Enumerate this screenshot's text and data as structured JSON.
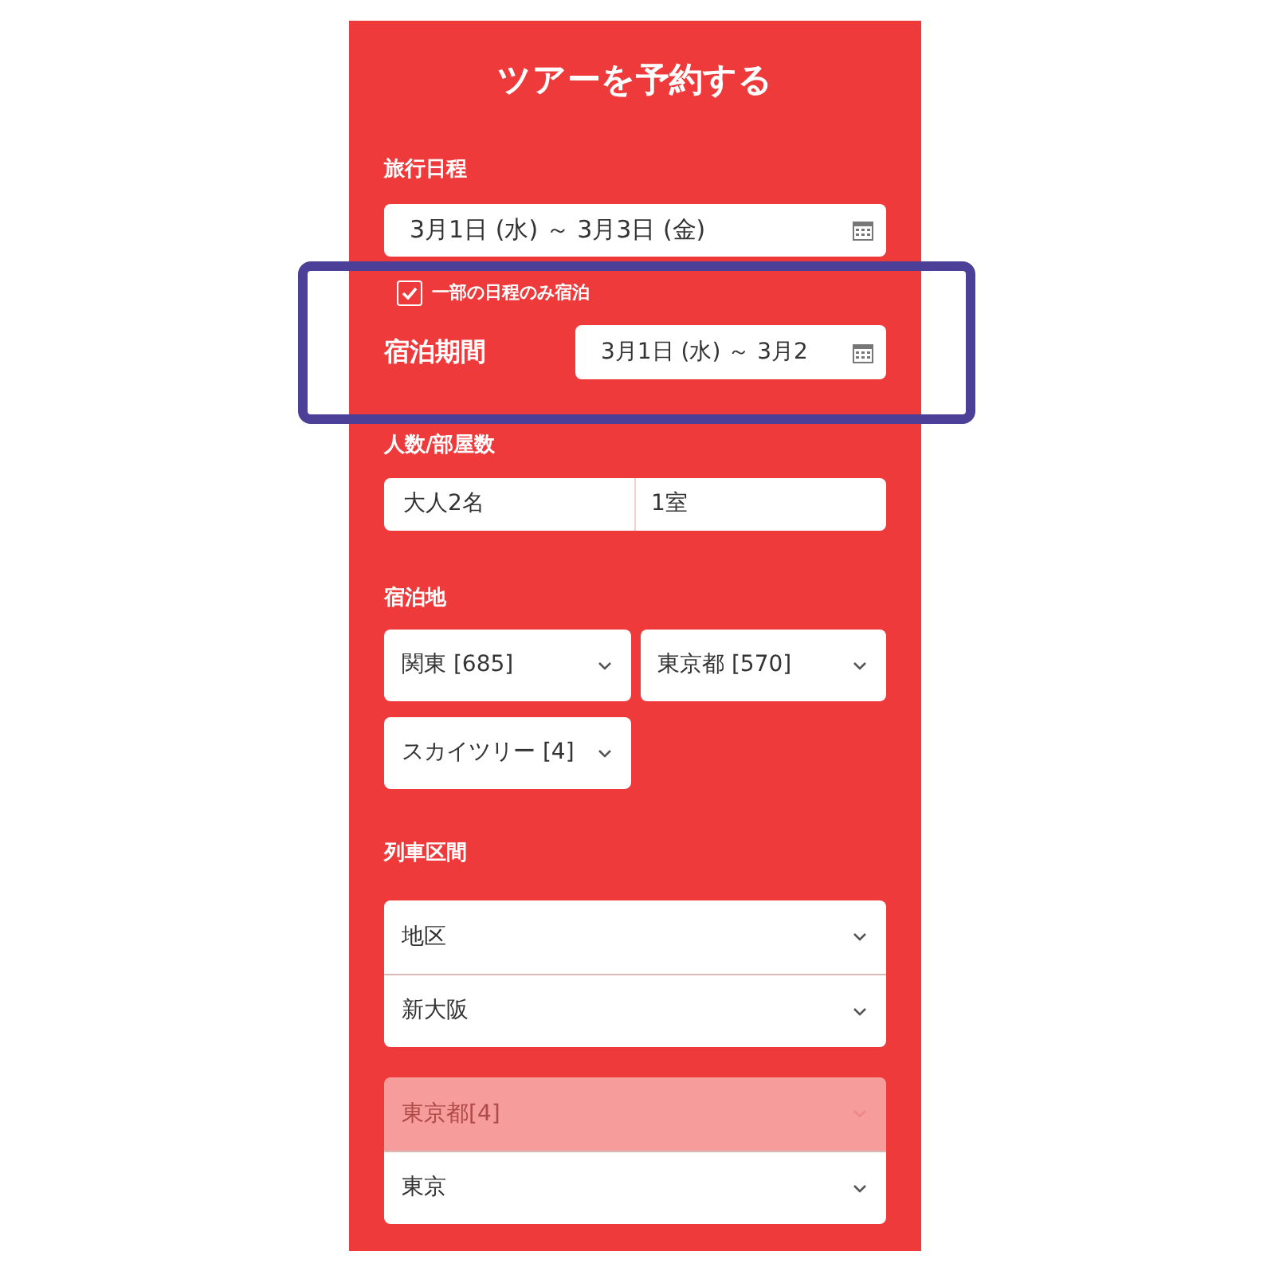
{
  "title": "ツアーを予約する",
  "itinerary": {
    "label": "旅行日程",
    "value": "3月1日 (水) ～ 3月3日 (金)"
  },
  "partial_stay": {
    "label": "一部の日程のみ宿泊",
    "checked": true
  },
  "stay_period": {
    "label": "宿泊期間",
    "value": "3月1日 (水) ～ 3月2"
  },
  "guests": {
    "label": "人数/部屋数",
    "adults": "大人2名",
    "rooms": "1室"
  },
  "stay_location": {
    "label": "宿泊地",
    "selects": [
      {
        "value": "関東 [685]",
        "disabled": false
      },
      {
        "value": "東京都 [570]",
        "disabled": false
      },
      {
        "value": "スカイツリー [4]",
        "disabled": false
      }
    ]
  },
  "train_section": {
    "label": "列車区間",
    "groups": [
      {
        "selects": [
          {
            "value": "地区",
            "disabled": false
          },
          {
            "value": "新大阪",
            "disabled": false
          }
        ]
      },
      {
        "selects": [
          {
            "value": "東京都[4]",
            "disabled": true
          },
          {
            "value": "東京",
            "disabled": false
          }
        ]
      }
    ]
  }
}
